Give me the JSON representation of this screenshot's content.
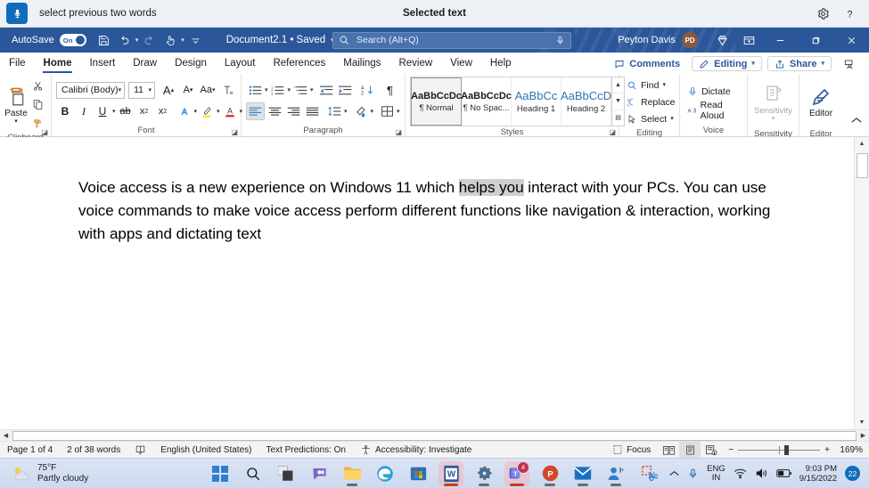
{
  "voice_access": {
    "mic_icon": "microphone-icon",
    "command_text": "select previous two words",
    "status_text": "Selected text",
    "settings_icon": "gear-icon",
    "help_icon": "help-icon"
  },
  "titlebar": {
    "autosave_label": "AutoSave",
    "autosave_state": "On",
    "quick_access": [
      {
        "name": "save-button",
        "icon": "save-icon"
      },
      {
        "name": "undo-button",
        "icon": "undo-icon"
      },
      {
        "name": "redo-button",
        "icon": "redo-icon"
      },
      {
        "name": "touch-mode-button",
        "icon": "touch-mode-icon"
      },
      {
        "name": "customize-quick-access-button",
        "icon": "chevron-down-icon"
      }
    ],
    "document_title": "Document2.1 • Saved",
    "search_placeholder": "Search (Alt+Q)",
    "search_value": "",
    "search_icon": "search-icon",
    "search_mic_icon": "microphone-icon",
    "account_name": "Peyton Davis",
    "account_initials": "PD",
    "premium_icon": "diamond-icon",
    "ribbon_display_icon": "ribbon-display-options-icon",
    "minimize_label": "—",
    "restore_label": "❐",
    "close_label": "✕"
  },
  "ribbon_tabs": [
    {
      "label": "File",
      "active": false
    },
    {
      "label": "Home",
      "active": true
    },
    {
      "label": "Insert",
      "active": false
    },
    {
      "label": "Draw",
      "active": false
    },
    {
      "label": "Design",
      "active": false
    },
    {
      "label": "Layout",
      "active": false
    },
    {
      "label": "References",
      "active": false
    },
    {
      "label": "Mailings",
      "active": false
    },
    {
      "label": "Review",
      "active": false
    },
    {
      "label": "View",
      "active": false
    },
    {
      "label": "Help",
      "active": false
    }
  ],
  "tabs_right": {
    "comments_label": "Comments",
    "comments_icon": "comment-icon",
    "editing_label": "Editing",
    "editing_icon": "pencil-icon",
    "share_label": "Share",
    "share_icon": "share-icon",
    "present_icon": "present-icon"
  },
  "ribbon": {
    "clipboard": {
      "group_name": "Clipboard",
      "paste_label": "Paste",
      "paste_icon": "clipboard-icon",
      "cut_icon": "scissors-icon",
      "copy_icon": "copy-icon",
      "format_painter_icon": "format-painter-icon",
      "launcher_icon": "dialog-launcher-icon"
    },
    "font": {
      "group_name": "Font",
      "font_family": "Calibri (Body)",
      "font_size": "11",
      "grow_font": "A",
      "shrink_font": "A",
      "change_case": "Aa",
      "clear_formatting_icon": "clear-formatting-icon",
      "bold": "B",
      "italic": "I",
      "underline": "U",
      "strikethrough_icon": "strikethrough-icon",
      "subscript": "x",
      "superscript": "x",
      "text_effects_icon": "text-effects-icon",
      "highlight_icon": "highlight-icon",
      "font_color_icon": "font-color-icon",
      "launcher_icon": "dialog-launcher-icon"
    },
    "paragraph": {
      "group_name": "Paragraph",
      "bullets_icon": "bullets-icon",
      "numbering_icon": "numbering-icon",
      "multilevel_icon": "multilevel-list-icon",
      "decrease_indent_icon": "decrease-indent-icon",
      "increase_indent_icon": "increase-indent-icon",
      "sort_icon": "sort-icon",
      "show_marks_icon": "paragraph-marks-icon",
      "align_left_icon": "align-left-icon",
      "align_center_icon": "align-center-icon",
      "align_right_icon": "align-right-icon",
      "justify_icon": "justify-icon",
      "line_spacing_icon": "line-spacing-icon",
      "shading_icon": "shading-icon",
      "borders_icon": "borders-icon",
      "launcher_icon": "dialog-launcher-icon"
    },
    "styles": {
      "group_name": "Styles",
      "items": [
        {
          "preview": "AaBbCcDc",
          "name": "¶ Normal",
          "selected": true,
          "heading": false
        },
        {
          "preview": "AaBbCcDc",
          "name": "¶ No Spac...",
          "selected": false,
          "heading": false
        },
        {
          "preview": "AaBbCc",
          "name": "Heading 1",
          "selected": false,
          "heading": true
        },
        {
          "preview": "AaBbCcD",
          "name": "Heading 2",
          "selected": false,
          "heading": true
        }
      ],
      "scroll_up_icon": "chevron-up-icon",
      "scroll_down_icon": "chevron-down-icon",
      "more_icon": "more-styles-icon",
      "launcher_icon": "dialog-launcher-icon"
    },
    "editing": {
      "group_name": "Editing",
      "find_label": "Find",
      "find_icon": "search-icon",
      "replace_label": "Replace",
      "replace_icon": "replace-icon",
      "select_label": "Select",
      "select_icon": "cursor-icon"
    },
    "voice": {
      "group_name": "Voice",
      "dictate_label": "Dictate",
      "dictate_icon": "microphone-icon",
      "read_aloud_label": "Read Aloud",
      "read_aloud_icon": "read-aloud-icon"
    },
    "sensitivity": {
      "group_name": "Sensitivity",
      "label": "Sensitivity",
      "icon": "sensitivity-icon",
      "disabled": true
    },
    "editor": {
      "group_name": "Editor",
      "label": "Editor",
      "icon": "editor-pen-icon"
    },
    "collapse_icon": "chevron-up-icon"
  },
  "document": {
    "paragraph_before_selection": "Voice access is a new experience on Windows 11 which ",
    "selected_text": "helps you",
    "paragraph_after_selection": " interact with your PCs. You can use voice commands to make voice access perform different functions like navigation & interaction, working with apps and dictating text"
  },
  "statusbar": {
    "page_label": "Page 1 of 4",
    "word_count": "2 of 38 words",
    "proofing_icon": "proofing-icon",
    "language": "English (United States)",
    "text_predictions": "Text Predictions: On",
    "accessibility": "Accessibility: Investigate",
    "accessibility_icon": "accessibility-icon",
    "focus_label": "Focus",
    "focus_icon": "focus-icon",
    "read_mode_icon": "read-mode-icon",
    "print_layout_icon": "print-layout-icon",
    "web_layout_icon": "web-layout-icon",
    "zoom_out_label": "−",
    "zoom_in_label": "+",
    "zoom_level": "169%"
  },
  "taskbar": {
    "weather_temp": "75°F",
    "weather_desc": "Partly cloudy",
    "weather_icon": "partly-cloudy-icon",
    "apps": [
      {
        "name": "start-button",
        "icon": "windows-start-icon",
        "active": false,
        "running": false,
        "badge": ""
      },
      {
        "name": "taskbar-search",
        "icon": "search-icon",
        "active": false,
        "running": false,
        "badge": ""
      },
      {
        "name": "task-view",
        "icon": "task-view-icon",
        "active": false,
        "running": false,
        "badge": ""
      },
      {
        "name": "chat",
        "icon": "chat-icon",
        "active": false,
        "running": false,
        "badge": ""
      },
      {
        "name": "file-explorer",
        "icon": "folder-icon",
        "active": false,
        "running": true,
        "badge": ""
      },
      {
        "name": "microsoft-edge",
        "icon": "edge-icon",
        "active": false,
        "running": false,
        "badge": ""
      },
      {
        "name": "microsoft-store",
        "icon": "store-icon",
        "active": false,
        "running": false,
        "badge": ""
      },
      {
        "name": "microsoft-word",
        "icon": "word-icon",
        "active": true,
        "running": true,
        "badge": ""
      },
      {
        "name": "settings",
        "icon": "gear-icon",
        "active": false,
        "running": true,
        "badge": ""
      },
      {
        "name": "microsoft-teams",
        "icon": "teams-icon",
        "active": true,
        "running": true,
        "badge": "4"
      },
      {
        "name": "microsoft-powerpoint",
        "icon": "powerpoint-icon",
        "active": false,
        "running": true,
        "badge": ""
      },
      {
        "name": "mail",
        "icon": "mail-icon",
        "active": false,
        "running": true,
        "badge": ""
      },
      {
        "name": "people-voice",
        "icon": "people-voice-icon",
        "active": false,
        "running": true,
        "badge": ""
      },
      {
        "name": "snipping-tool",
        "icon": "snipping-tool-icon",
        "active": false,
        "running": false,
        "badge": ""
      }
    ],
    "tray": {
      "overflow_icon": "chevron-up-icon",
      "mic_icon": "microphone-icon",
      "language_line1": "ENG",
      "language_line2": "IN",
      "wifi_icon": "wifi-icon",
      "volume_icon": "volume-icon",
      "battery_icon": "battery-icon",
      "time": "9:03 PM",
      "date": "9/15/2022",
      "notification_count": "22"
    }
  },
  "colors": {
    "word_blue": "#2b579a",
    "accent_blue": "#0f6cbd",
    "selection_gray": "#cfcfcf",
    "voice_bar_bg": "#eef2f7"
  }
}
